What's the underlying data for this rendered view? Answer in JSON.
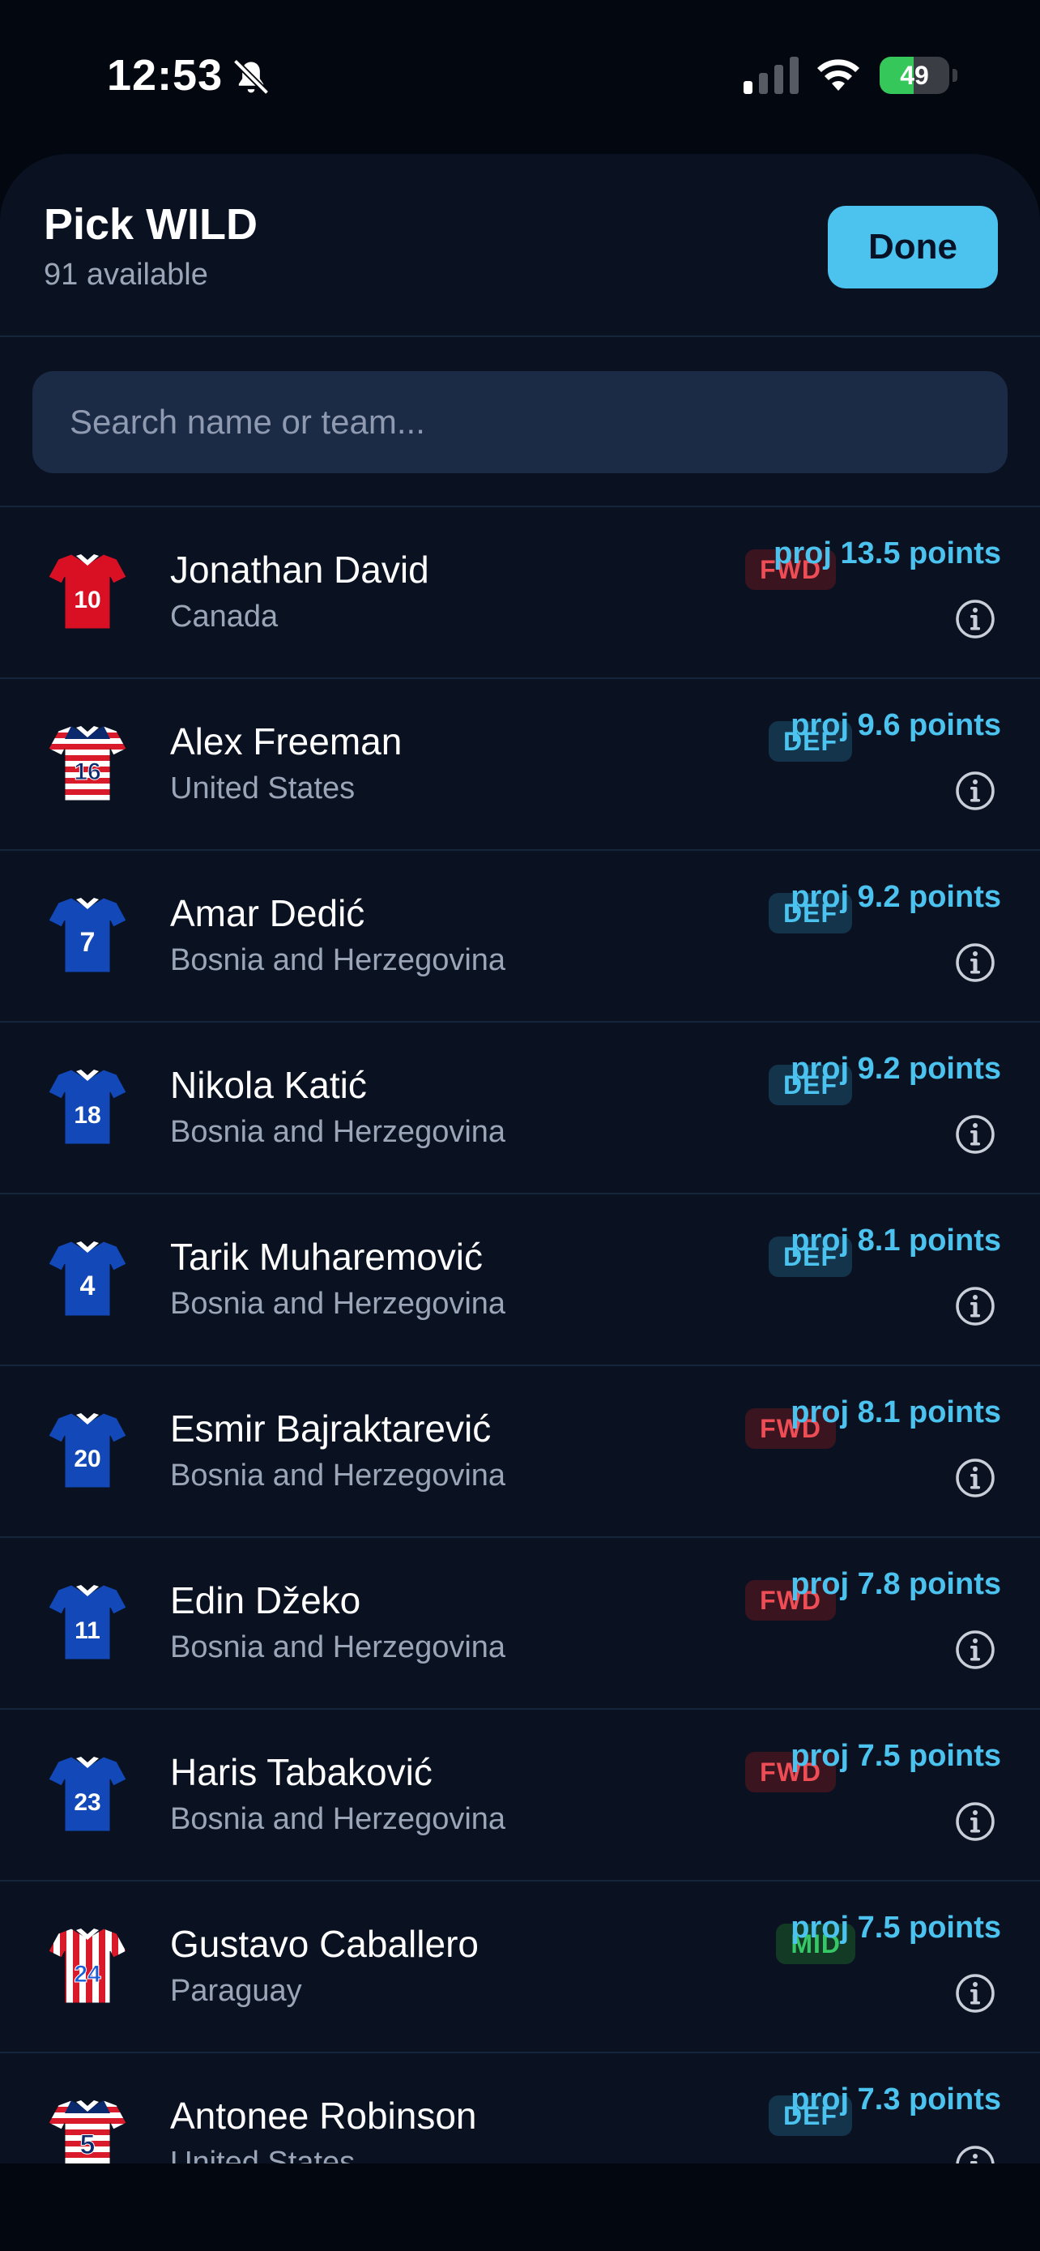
{
  "status_bar": {
    "time": "12:53",
    "battery_percent": "49",
    "battery_level": 0.49,
    "signal_bars_active": 1
  },
  "sheet": {
    "title": "Pick WILD",
    "subtitle": "91 available",
    "done_label": "Done",
    "search_placeholder": "Search name or team..."
  },
  "players": [
    {
      "name": "Jonathan David",
      "country": "Canada",
      "position": "FWD",
      "proj": "proj 13.5 points",
      "number": "10",
      "kit": "red"
    },
    {
      "name": "Alex Freeman",
      "country": "United States",
      "position": "DEF",
      "proj": "proj 9.6 points",
      "number": "16",
      "kit": "stripes-h"
    },
    {
      "name": "Amar Dedić",
      "country": "Bosnia and Herzegovina",
      "position": "DEF",
      "proj": "proj 9.2 points",
      "number": "7",
      "kit": "blue"
    },
    {
      "name": "Nikola Katić",
      "country": "Bosnia and Herzegovina",
      "position": "DEF",
      "proj": "proj 9.2 points",
      "number": "18",
      "kit": "blue"
    },
    {
      "name": "Tarik Muharemović",
      "country": "Bosnia and Herzegovina",
      "position": "DEF",
      "proj": "proj 8.1 points",
      "number": "4",
      "kit": "blue"
    },
    {
      "name": "Esmir Bajraktarević",
      "country": "Bosnia and Herzegovina",
      "position": "FWD",
      "proj": "proj 8.1 points",
      "number": "20",
      "kit": "blue"
    },
    {
      "name": "Edin Džeko",
      "country": "Bosnia and Herzegovina",
      "position": "FWD",
      "proj": "proj 7.8 points",
      "number": "11",
      "kit": "blue"
    },
    {
      "name": "Haris Tabaković",
      "country": "Bosnia and Herzegovina",
      "position": "FWD",
      "proj": "proj 7.5 points",
      "number": "23",
      "kit": "blue"
    },
    {
      "name": "Gustavo Caballero",
      "country": "Paraguay",
      "position": "MID",
      "proj": "proj 7.5 points",
      "number": "24",
      "kit": "stripes-v"
    },
    {
      "name": "Antonee Robinson",
      "country": "United States",
      "position": "DEF",
      "proj": "proj 7.3 points",
      "number": "5",
      "kit": "stripes-h"
    }
  ],
  "colors": {
    "accent": "#4cc2ef",
    "background": "#0a1222",
    "fwd": "#ee4d55",
    "def": "#4cc2ef",
    "mid": "#36c866"
  }
}
